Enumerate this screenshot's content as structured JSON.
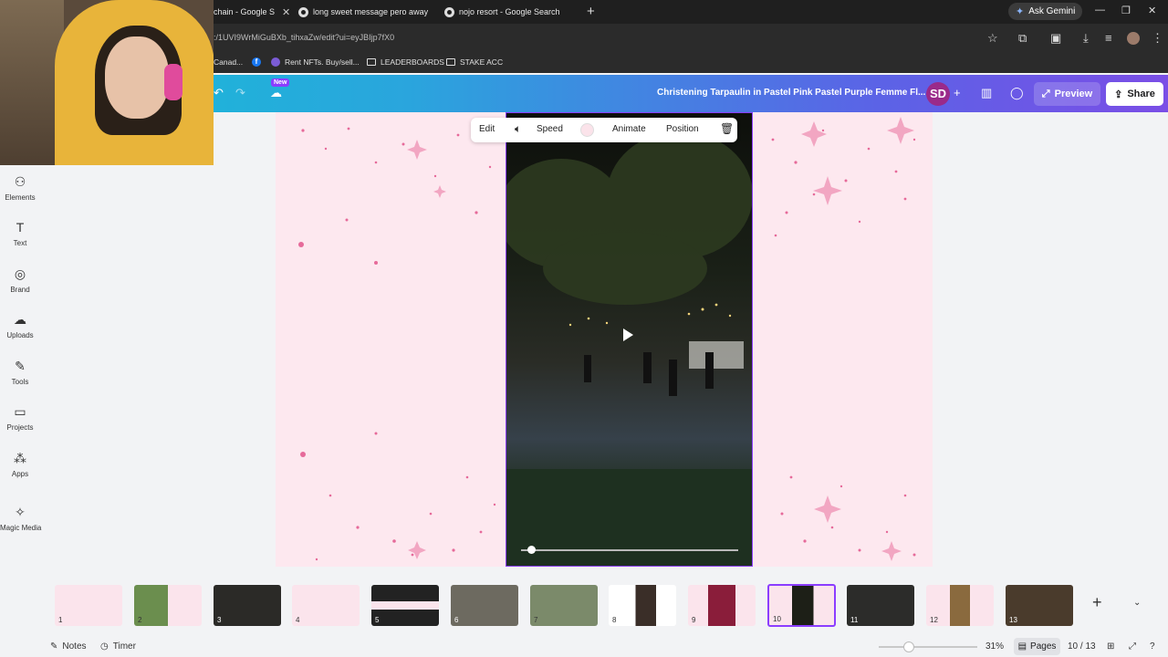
{
  "browser": {
    "tabs": [
      {
        "label": "chain - Google S"
      },
      {
        "label": "long sweet message pero away"
      },
      {
        "label": "nojo resort - Google Search"
      }
    ],
    "new_tab": "+",
    "ask_gemini": "Ask Gemini",
    "url": ":/1UVI9WrMiGuBXb_tihxaZw/edit?ui=eyJBIjp7fX0",
    "bookmarks": [
      {
        "label": "Canad..."
      },
      {
        "label": "Rent NFTs. Buy/sell..."
      },
      {
        "label": "LEADERBOARDS"
      },
      {
        "label": "STAKE ACC"
      }
    ]
  },
  "header": {
    "new_badge": "New",
    "doc_title": "Christening Tarpaulin in Pastel Pink Pastel Purple Femme Fl...",
    "avatar_initials": "SD",
    "preview": "Preview",
    "share": "Share"
  },
  "sidebar": {
    "items": [
      {
        "label": "Elements",
        "icon": "elements-icon"
      },
      {
        "label": "Text",
        "icon": "text-icon"
      },
      {
        "label": "Brand",
        "icon": "brand-icon"
      },
      {
        "label": "Uploads",
        "icon": "uploads-icon"
      },
      {
        "label": "Tools",
        "icon": "tools-icon"
      },
      {
        "label": "Projects",
        "icon": "projects-icon"
      },
      {
        "label": "Apps",
        "icon": "apps-icon"
      },
      {
        "label": "Magic Media",
        "icon": "magic-media-icon"
      }
    ]
  },
  "toolbar": {
    "edit": "Edit",
    "speed": "Speed",
    "animate": "Animate",
    "position": "Position"
  },
  "pages": {
    "numbers": [
      "1",
      "2",
      "3",
      "4",
      "5",
      "6",
      "7",
      "8",
      "9",
      "10",
      "11",
      "12",
      "13"
    ],
    "selected": "10"
  },
  "footer": {
    "notes": "Notes",
    "timer": "Timer",
    "zoom": "31%",
    "pages": "Pages",
    "page_count": "10 / 13"
  },
  "colors": {
    "accent": "#8b3dff",
    "page_bg": "#fde8ef",
    "star": "#e66a9a"
  }
}
